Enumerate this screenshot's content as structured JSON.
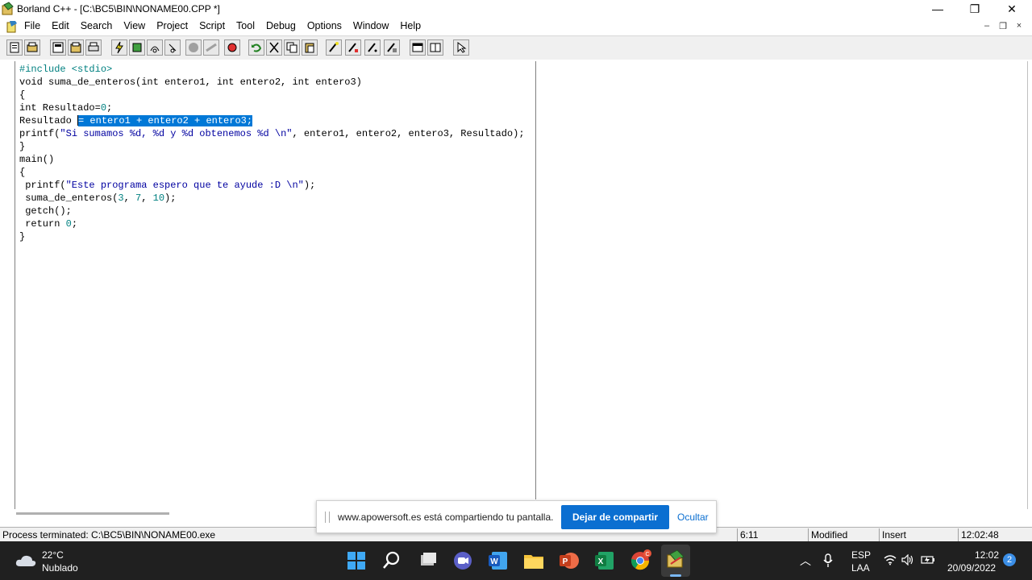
{
  "window": {
    "title": "Borland C++ - [C:\\BC5\\BIN\\NONAME00.CPP *]",
    "minimize": "—",
    "maximize": "❐",
    "close": "✕"
  },
  "menu": {
    "items": [
      "File",
      "Edit",
      "Search",
      "View",
      "Project",
      "Script",
      "Tool",
      "Debug",
      "Options",
      "Window",
      "Help"
    ],
    "mdi_min": "–",
    "mdi_restore": "❐",
    "mdi_close": "×"
  },
  "editor": {
    "lines": [
      {
        "parts": [
          {
            "t": "#include <stdio>",
            "c": "kw-inc"
          }
        ]
      },
      {
        "parts": [
          {
            "t": "void suma_de_enteros(int entero1, int entero2, int entero3)"
          }
        ]
      },
      {
        "parts": [
          {
            "t": "{"
          }
        ]
      },
      {
        "parts": [
          {
            "t": "int Resultado="
          },
          {
            "t": "0",
            "c": "num"
          },
          {
            "t": ";"
          }
        ]
      },
      {
        "parts": [
          {
            "t": "Resultado "
          },
          {
            "cursor": true
          },
          {
            "t": "= entero1 + entero2 + entero3;",
            "c": "sel"
          }
        ]
      },
      {
        "parts": [
          {
            "t": "printf("
          },
          {
            "t": "\"Si sumamos %d, %d y %d obtenemos %d \\n\"",
            "c": "str"
          },
          {
            "t": ", entero1, entero2, entero3, Resultado);"
          }
        ]
      },
      {
        "parts": [
          {
            "t": "}"
          }
        ]
      },
      {
        "parts": [
          {
            "t": "main()"
          }
        ]
      },
      {
        "parts": [
          {
            "t": "{"
          }
        ]
      },
      {
        "parts": [
          {
            "t": " printf("
          },
          {
            "t": "\"Este programa espero que te ayude :D \\n\"",
            "c": "str"
          },
          {
            "t": ");"
          }
        ]
      },
      {
        "parts": [
          {
            "t": " suma_de_enteros("
          },
          {
            "t": "3",
            "c": "num"
          },
          {
            "t": ", "
          },
          {
            "t": "7",
            "c": "num"
          },
          {
            "t": ", "
          },
          {
            "t": "10",
            "c": "num"
          },
          {
            "t": ");"
          }
        ]
      },
      {
        "parts": [
          {
            "t": " getch();"
          }
        ]
      },
      {
        "parts": [
          {
            "t": " return "
          },
          {
            "t": "0",
            "c": "num"
          },
          {
            "t": ";"
          }
        ]
      },
      {
        "parts": [
          {
            "t": "}"
          }
        ]
      }
    ]
  },
  "status": {
    "message": "Process terminated: C:\\BC5\\BIN\\NONAME00.exe",
    "position": "6:11",
    "modified": "Modified",
    "mode": "Insert",
    "time": "12:02:48"
  },
  "share": {
    "text": "www.apowersoft.es está compartiendo tu pantalla.",
    "stop_label": "Dejar de compartir",
    "hide_label": "Ocultar"
  },
  "taskbar": {
    "weather_temp": "22°C",
    "weather_desc": "Nublado",
    "lang_top": "ESP",
    "lang_bottom": "LAA",
    "clock_time": "12:02",
    "clock_date": "20/09/2022",
    "notifications": "2",
    "chrome_badge": "C"
  },
  "colors": {
    "selection": "#0078d7",
    "string": "#0000a0",
    "number": "#008080",
    "taskbar": "#202020",
    "share_button": "#0b6fd1"
  }
}
